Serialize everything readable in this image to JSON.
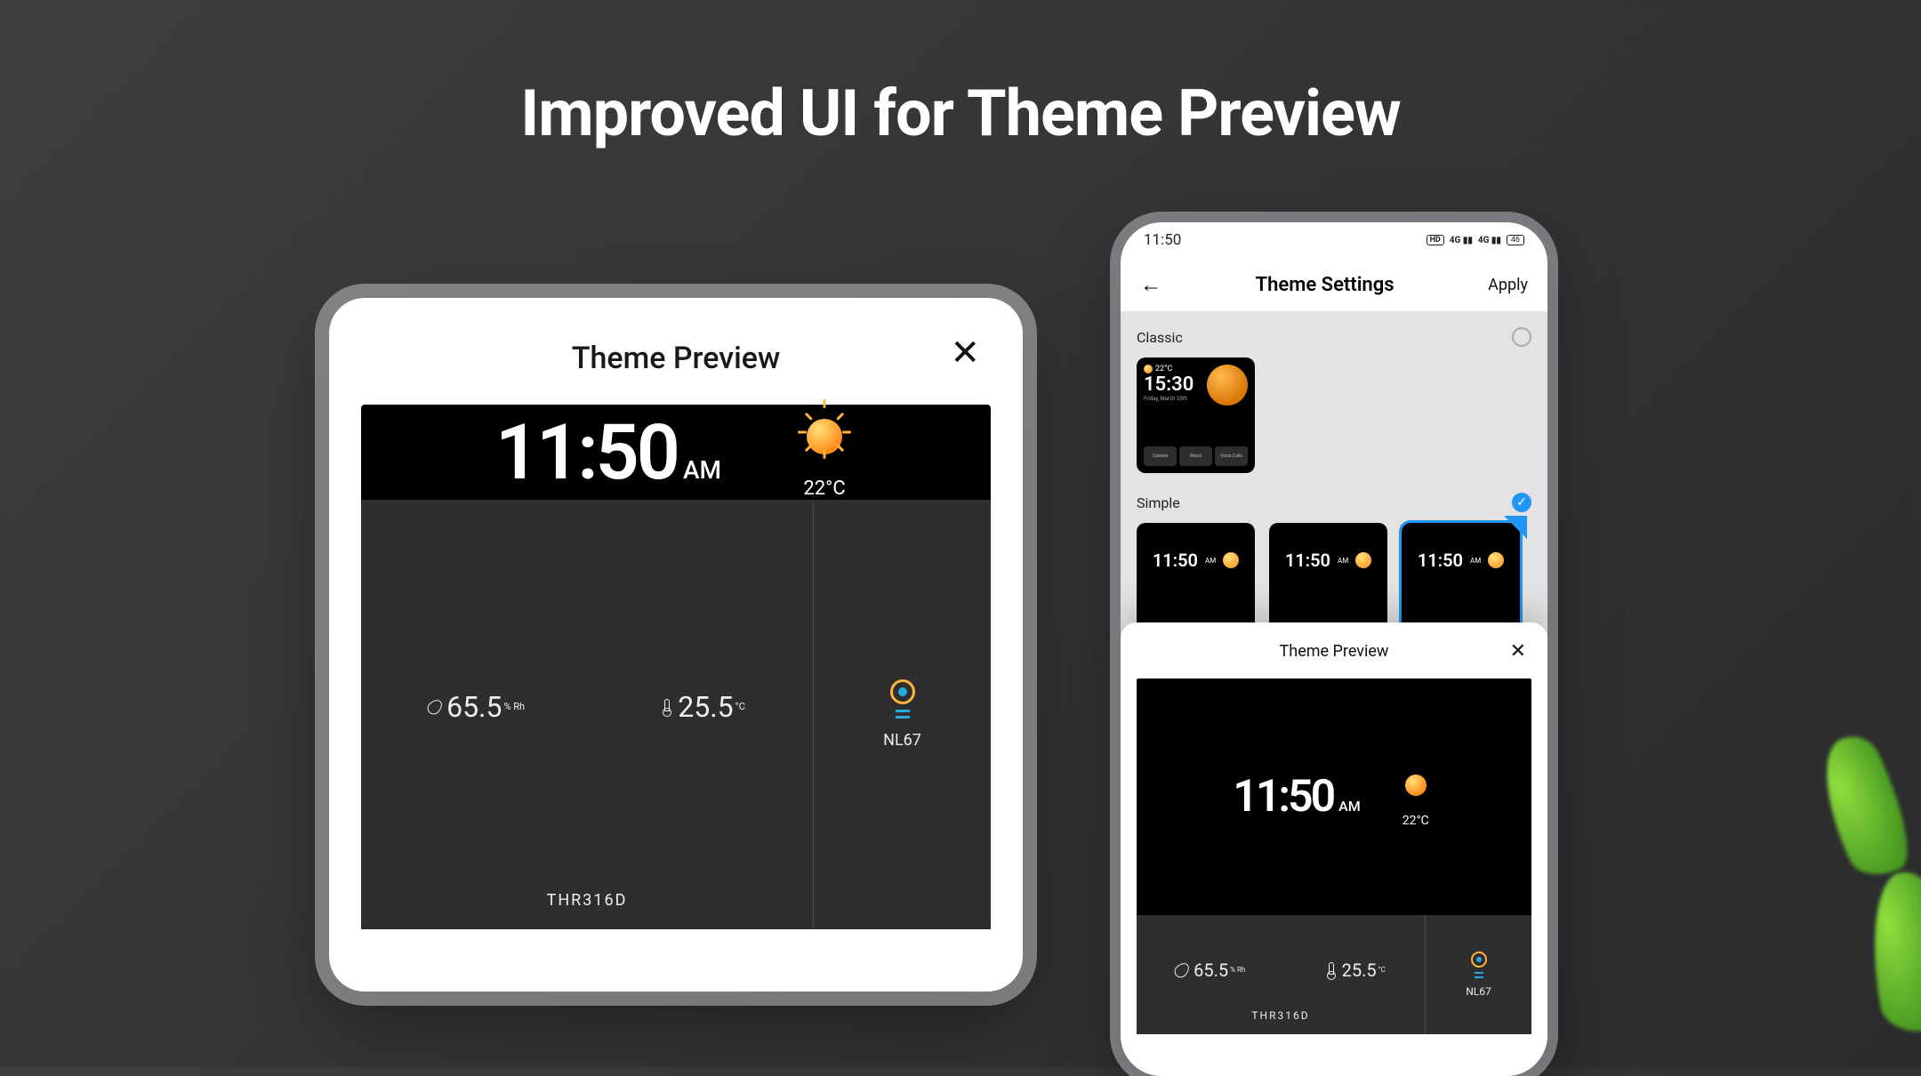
{
  "headline": "Improved UI for Theme Preview",
  "preview_panel": {
    "title": "Theme Preview",
    "time": "11:50",
    "time_suffix": "AM",
    "temperature": "22°C",
    "humidity": "65.5",
    "humidity_unit": "%\nRh",
    "sensor_temp": "25.5",
    "sensor_temp_unit": "°C",
    "sensor_name": "THR316D",
    "device_name": "NL67"
  },
  "phone": {
    "status_time": "11:50",
    "status_batt": "46",
    "nav_title": "Theme Settings",
    "nav_action": "Apply",
    "cat_classic": "Classic",
    "cat_simple": "Simple",
    "classic_thumb": {
      "temp": "22°C",
      "time": "15:30",
      "date": "Friday, March 25th",
      "tabs": [
        "Camera",
        "About",
        "Voice Calls"
      ]
    },
    "simple_thumbs": [
      {
        "time": "11:50",
        "suffix": "AM"
      },
      {
        "time": "11:50",
        "suffix": "AM"
      },
      {
        "time": "11:50",
        "suffix": "AM"
      }
    ],
    "sheet": {
      "title": "Theme Preview",
      "time": "11:50",
      "time_suffix": "AM",
      "temperature": "22°C",
      "humidity": "65.5",
      "humidity_unit": "%\nRh",
      "sensor_temp": "25.5",
      "sensor_temp_unit": "°C",
      "sensor_name": "THR316D",
      "device_name": "NL67"
    }
  }
}
